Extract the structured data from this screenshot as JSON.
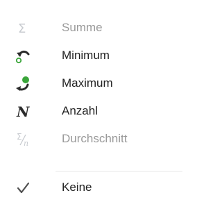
{
  "menu": {
    "items": [
      {
        "label": "Summe",
        "icon": "sum-icon",
        "enabled": false
      },
      {
        "label": "Minimum",
        "icon": "minimum-icon",
        "enabled": true
      },
      {
        "label": "Maximum",
        "icon": "maximum-icon",
        "enabled": true
      },
      {
        "label": "Anzahl",
        "icon": "count-icon",
        "enabled": true
      },
      {
        "label": "Durchschnitt",
        "icon": "average-icon",
        "enabled": false
      },
      {
        "label": "Keine",
        "icon": "checkmark-icon",
        "enabled": true,
        "checked": true
      }
    ]
  },
  "colors": {
    "text": "#222222",
    "disabled_text": "#9a9a9a",
    "icon_dark": "#2b2b2b",
    "icon_green": "#3aa53a",
    "separator": "#e6e6e6"
  }
}
